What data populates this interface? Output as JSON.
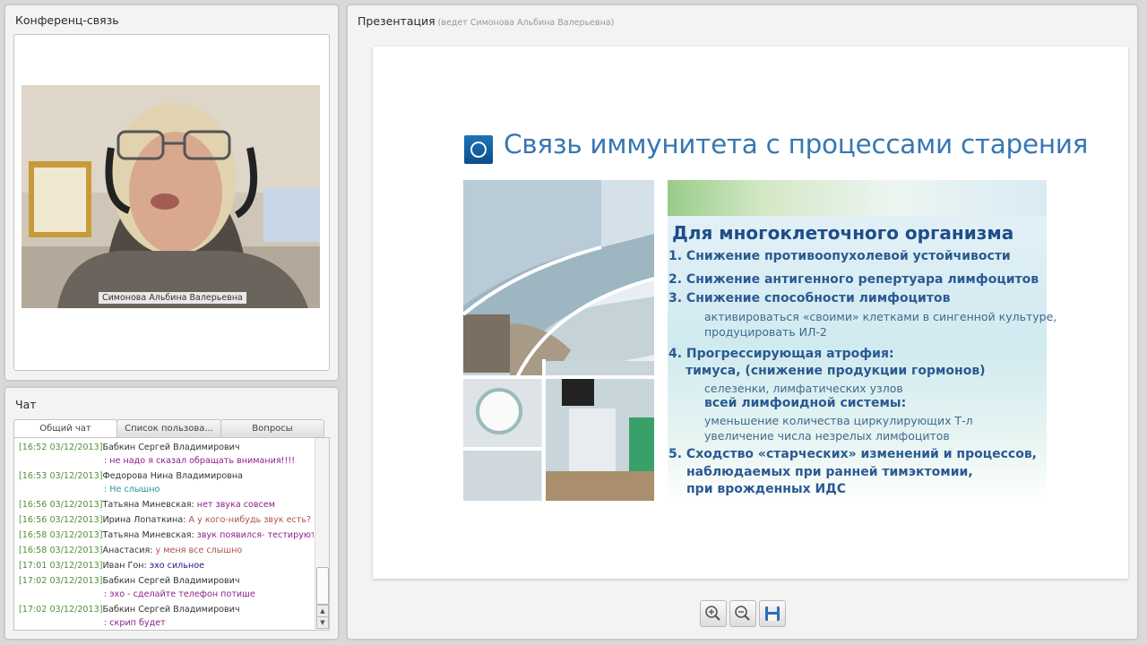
{
  "conference": {
    "title": "Конференц-связь",
    "video_caption": "Симонова Альбина Валерьевна"
  },
  "chat": {
    "title": "Чат",
    "tabs": [
      "Общий чат",
      "Список пользова...",
      "Вопросы"
    ],
    "messages": [
      {
        "ts": "[16:52 03/12/2013]",
        "name": "Бабкин Сергей Владимирович",
        "text": ": не надо я сказал обращать внимания!!!!",
        "wrap": true,
        "color": "c0"
      },
      {
        "ts": "[16:53 03/12/2013]",
        "name": "Федорова Нина Владимировна",
        "text": ": Не слышно",
        "wrap": true,
        "color": "c1"
      },
      {
        "ts": "[16:56 03/12/2013]",
        "name": "Татьяна Миневская:",
        "text": "нет звука совсем",
        "wrap": false,
        "color": "c0"
      },
      {
        "ts": "[16:56 03/12/2013]",
        "name": "Ирина Лопаткина:",
        "text": "А у кого-нибудь звук есть?",
        "wrap": false,
        "color": "c2"
      },
      {
        "ts": "[16:58 03/12/2013]",
        "name": "Татьяна Миневская:",
        "text": "звук появился- тестируют",
        "wrap": false,
        "color": "c0"
      },
      {
        "ts": "[16:58 03/12/2013]",
        "name": "Анастасия:",
        "text": "у меня все слышно",
        "wrap": false,
        "color": "c2"
      },
      {
        "ts": "[17:01 03/12/2013]",
        "name": "Иван Гон:",
        "text": "эхо сильное",
        "wrap": false,
        "color": "c3"
      },
      {
        "ts": "[17:02 03/12/2013]",
        "name": "Бабкин Сергей Владимирович",
        "text": ": эхо - сделайте телефон потише",
        "wrap": true,
        "color": "c0"
      },
      {
        "ts": "[17:02 03/12/2013]",
        "name": "Бабкин Сергей Владимирович",
        "text": ": скрип будет",
        "wrap": true,
        "color": "c0"
      }
    ]
  },
  "presentation": {
    "title": "Презентация",
    "subtitle": "(ведет Симонова Альбина Валерьевна)",
    "slide": {
      "heading": "Связь иммунитета с процессами старения",
      "subtitle": "Для многоклеточного организма",
      "items": [
        "1.  Снижение противоопухолевой  устойчивости",
        "2.  Снижение антигенного репертуара  лимфоцитов",
        "3.  Снижение способности лимфоцитов",
        "активироваться  «своими» клетками в сингенной культуре,",
        "продуцировать ИЛ-2",
        "4.  Прогрессирующая атрофия:",
        "тимуса, (снижение продукции гормонов)",
        "селезенки, лимфатических узлов",
        "всей лимфоидной системы:",
        "уменьшение количества циркулирующих Т-л",
        "увеличение  числа незрелых  лимфоцитов",
        "5.  Сходство «старческих» изменений и процессов,",
        "наблюдаемых при ранней тимэктомии,",
        "при врожденных ИДС"
      ]
    },
    "toolbar": {
      "zoom_in": "zoom-in-icon",
      "zoom_out": "zoom-out-icon",
      "save": "save-icon"
    }
  }
}
